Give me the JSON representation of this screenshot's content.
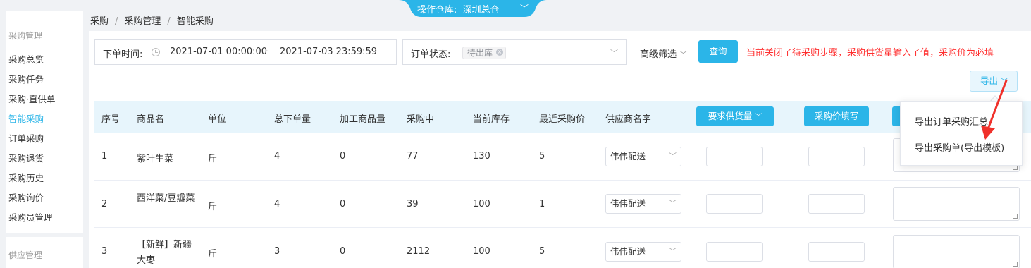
{
  "header": {
    "breadcrumb": [
      "采购",
      "采购管理",
      "智能采购"
    ],
    "warehouse_label": "操作仓库:",
    "warehouse_value": "深圳总仓"
  },
  "sidebar": {
    "group1": "采购管理",
    "items": [
      "采购总览",
      "采购任务",
      "采购·直供单",
      "智能采购",
      "订单采购",
      "采购退货",
      "采购历史",
      "采购询价",
      "采购员管理"
    ],
    "active_index": 3,
    "group2": "供应管理"
  },
  "filters": {
    "order_time_label": "下单时间:",
    "start_time": "2021-07-01 00:00:00",
    "range_sep": "-",
    "end_time": "2021-07-03 23:59:59",
    "order_status_label": "订单状态:",
    "order_status_tag": "待出库",
    "advanced_filter": "高级筛选",
    "query_button": "查询",
    "notice": "当前关闭了待采购步骤，采购供货量输入了值，采购价为必填",
    "export_button": "导出"
  },
  "table": {
    "headers": {
      "index": "序号",
      "product": "商品名",
      "unit": "单位",
      "total_order": "总下单量",
      "processed": "加工商品量",
      "purchasing": "采购中",
      "stock": "当前库存",
      "recent_price": "最近采购价",
      "supplier": "供应商名字",
      "required_supply": "要求供货量",
      "price_fill": "采购价填写"
    },
    "rows": [
      {
        "index": "1",
        "product": "紫叶生菜",
        "unit": "斤",
        "total_order": "4",
        "processed": "0",
        "purchasing": "77",
        "stock": "130",
        "recent_price": "5",
        "supplier": "伟伟配送"
      },
      {
        "index": "2",
        "product": "西洋菜/豆瓣菜",
        "unit": "斤",
        "total_order": "4",
        "processed": "0",
        "purchasing": "39",
        "stock": "100",
        "recent_price": "1",
        "supplier": "伟伟配送"
      },
      {
        "index": "3",
        "product": "【新鲜】新疆大枣",
        "unit": "斤",
        "total_order": "3",
        "processed": "0",
        "purchasing": "2112",
        "stock": "100",
        "recent_price": "5",
        "supplier": "伟伟配送"
      }
    ]
  },
  "export_menu": {
    "items": [
      "导出订单采购汇总",
      "导出采购单(导出模板)"
    ]
  },
  "colors": {
    "accent": "#2bb5e8",
    "notice": "#ff2f2f",
    "annotation_arrow": "#f0302a"
  }
}
